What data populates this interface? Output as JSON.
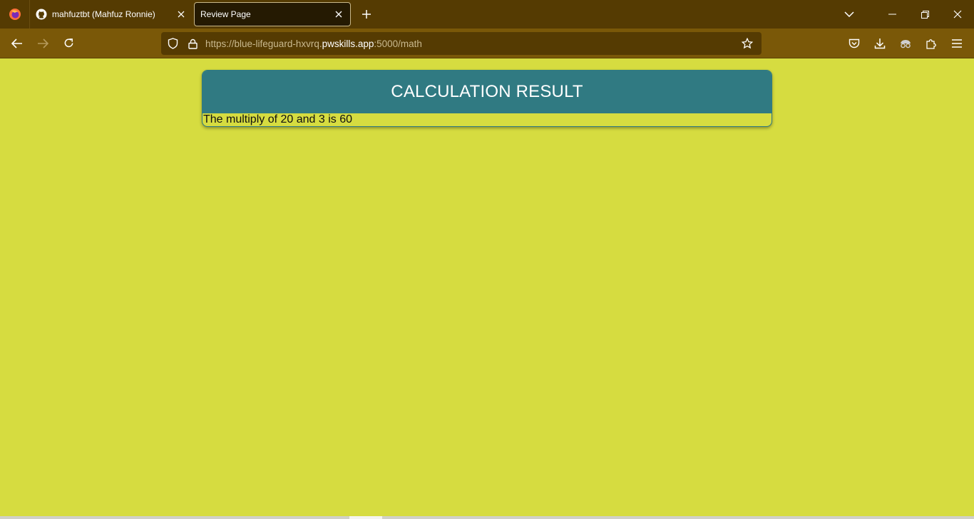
{
  "tabs": [
    {
      "title": "mahfuztbt (Mahfuz Ronnie)",
      "icon": "github-icon",
      "active": false
    },
    {
      "title": "Review Page",
      "icon": "",
      "active": true
    }
  ],
  "url": {
    "prefix": "https://blue-lifeguard-hxvrq.",
    "host": "pwskills.app",
    "suffix": ":5000/math"
  },
  "card": {
    "title": "CALCULATION RESULT",
    "result": "The multiply of 20 and 3 is 60"
  },
  "colors": {
    "page_background": "#d6dc40",
    "card_header": "#307a82",
    "tabbar": "#553b02",
    "navbar": "#7a5808"
  }
}
